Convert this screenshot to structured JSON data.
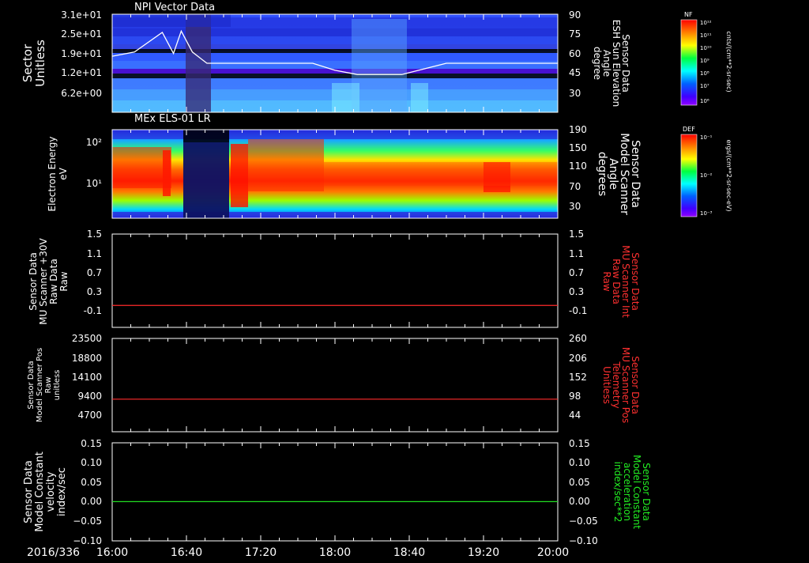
{
  "colors": {
    "background": "#000000",
    "axis": "#ffffff",
    "red_trace": "#ff2a2a",
    "green_trace": "#22dd22",
    "red_label": "#ff3030",
    "green_label": "#22ee22"
  },
  "chart_data": [
    {
      "type": "heatmap",
      "title": "NPI Vector Data",
      "left_ylabel": [
        "Sector",
        "Unitless"
      ],
      "left_ticks": [
        "3.1e+01",
        "2.5e+01",
        "1.9e+01",
        "1.2e+01",
        "6.2e+00"
      ],
      "right_ylabel": [
        "Sensor Data",
        "ESH Sun Elevation",
        "Angle",
        "degree"
      ],
      "right_ticks": [
        "90",
        "75",
        "60",
        "45",
        "30"
      ],
      "overlay_series": {
        "name": "ESH Sun Elevation Angle",
        "x_hours": [
          16.0,
          16.2,
          16.45,
          16.55,
          16.62,
          16.72,
          16.85,
          16.95,
          17.3,
          17.6,
          17.8,
          18.0,
          18.2,
          18.4,
          18.6,
          18.8,
          19.0,
          19.3,
          19.6,
          20.0
        ],
        "y_degree": [
          60,
          63,
          77,
          62,
          78,
          63,
          55,
          55,
          55,
          55,
          55,
          50,
          47,
          47,
          47,
          51,
          55,
          55,
          55,
          55
        ]
      },
      "colorbar": {
        "label": "NF",
        "units": "cnts/(cm**2-sr-sec)",
        "ticks": [
          "10¹²",
          "10¹¹",
          "10¹⁰",
          "10⁹",
          "10⁸",
          "10⁷",
          "10⁶"
        ]
      }
    },
    {
      "type": "heatmap",
      "title": "MEx ELS-01 LR",
      "left_ylabel": [
        "Electron Energy",
        "eV"
      ],
      "left_ticks": [
        "10²",
        "10¹"
      ],
      "right_ylabel": [
        "Sensor Data",
        "Model Scanner",
        "Angle",
        "degrees"
      ],
      "right_ticks": [
        "190",
        "150",
        "110",
        "70",
        "30"
      ],
      "colorbar": {
        "label": "DEF",
        "units": "ergs/(cm**2-sr-sec-eV)",
        "ticks": [
          "10⁻¹",
          "10⁻²",
          "10⁻³"
        ]
      }
    },
    {
      "type": "line",
      "left_ylabel": [
        "Sensor Data",
        "MU Scanner +30V",
        "Raw Data",
        "Raw"
      ],
      "left_ticks": [
        "1.5",
        "1.1",
        "0.7",
        "0.3",
        "-0.1"
      ],
      "right_ylabel": [
        "Sensor Data",
        "MU Scanner Int",
        "Raw Data",
        "Raw"
      ],
      "right_ticks": [
        "1.5",
        "1.1",
        "0.7",
        "0.3",
        "-0.1"
      ],
      "ylim": [
        -0.5,
        1.5
      ],
      "series": [
        {
          "x_hours": [
            16.0,
            20.0
          ],
          "values": [
            -0.03,
            -0.03
          ]
        }
      ]
    },
    {
      "type": "line",
      "left_ylabel": [
        "Sensor Data",
        "Model Scanner Pos",
        "Raw",
        "unitless"
      ],
      "left_ticks": [
        "23500",
        "18800",
        "14100",
        "9400",
        "4700"
      ],
      "right_ylabel": [
        "Sensor Data",
        "MU Scanner Pos",
        "Telemetry",
        "Unitless"
      ],
      "right_ticks": [
        "260",
        "206",
        "152",
        "98",
        "44"
      ],
      "ylim": [
        0,
        23500
      ],
      "series": [
        {
          "x_hours": [
            16.0,
            20.0
          ],
          "values": [
            8200,
            8200
          ]
        }
      ]
    },
    {
      "type": "line",
      "left_ylabel": [
        "Sensor Data",
        "Model Constant",
        "velocity",
        "index/sec"
      ],
      "left_ticks": [
        "0.15",
        "0.10",
        "0.05",
        "0.00",
        "−0.05",
        "−0.10"
      ],
      "right_ylabel": [
        "Sensor Data",
        "Model Constant",
        "acceleration",
        "index/sec**2"
      ],
      "right_ticks": [
        "0.15",
        "0.10",
        "0.05",
        "0.00",
        "−0.05",
        "−0.10"
      ],
      "ylim": [
        -0.1,
        0.15
      ],
      "series": [
        {
          "x_hours": [
            16.0,
            20.0
          ],
          "values": [
            0.0,
            0.0
          ]
        }
      ]
    }
  ],
  "x_axis": {
    "date_label": "2016/336",
    "range_hours": [
      16.0,
      20.0
    ],
    "tick_labels": [
      "16:00",
      "16:40",
      "17:20",
      "18:00",
      "18:40",
      "19:20",
      "20:00"
    ]
  }
}
